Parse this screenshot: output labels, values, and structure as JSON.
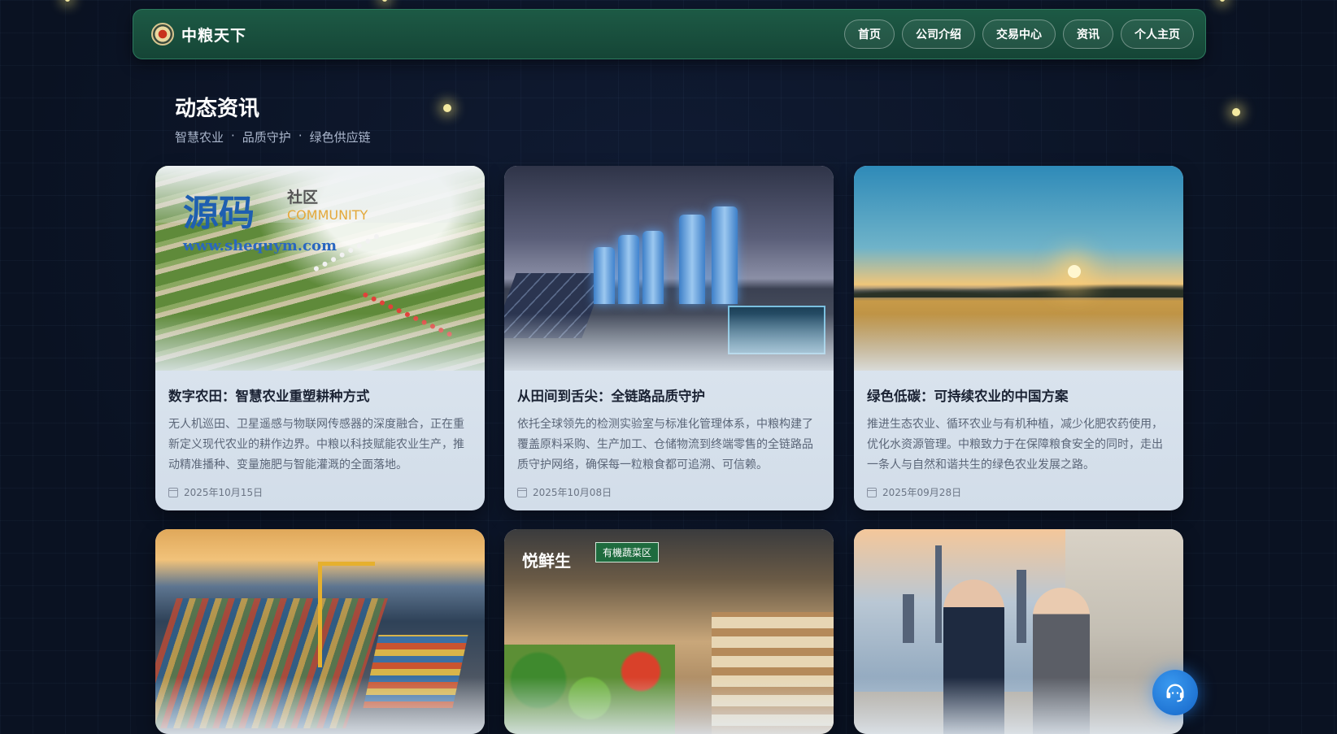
{
  "brand": {
    "name": "中粮天下"
  },
  "nav": {
    "items": [
      "首页",
      "公司介绍",
      "交易中心",
      "资讯",
      "个人主页"
    ]
  },
  "section": {
    "title": "动态资讯",
    "tags": [
      "智慧农业",
      "品质守护",
      "绿色供应链"
    ],
    "separator": "·"
  },
  "watermark": {
    "main": "源码",
    "community_cn": "社区",
    "community_en": "COMMUNITY",
    "url": "www.shequym.com"
  },
  "news": [
    {
      "title": "数字农田：智慧农业重塑耕种方式",
      "desc": "无人机巡田、卫星遥感与物联网传感器的深度融合，正在重新定义现代农业的耕作边界。中粮以科技赋能农业生产，推动精准播种、变量施肥与智能灌溉的全面落地。",
      "date": "2025年10月15日"
    },
    {
      "title": "从田间到舌尖：全链路品质守护",
      "desc": "依托全球领先的检测实验室与标准化管理体系，中粮构建了覆盖原料采购、生产加工、仓储物流到终端零售的全链路品质守护网络，确保每一粒粮食都可追溯、可信赖。",
      "date": "2025年10月08日"
    },
    {
      "title": "绿色低碳：可持续农业的中国方案",
      "desc": "推进生态农业、循环农业与有机种植，减少化肥农药使用，优化水资源管理。中粮致力于在保障粮食安全的同时，走出一条人与自然和谐共生的绿色农业发展之路。",
      "date": "2025年09月28日"
    }
  ],
  "market_signs": {
    "brand": "悦鲜生",
    "zone": "有機蔬菜区"
  },
  "colors": {
    "nav_bg": "#1d5a45",
    "page_bg": "#0b1426",
    "support": "#1565c8"
  },
  "icons": {
    "support": "headset-icon",
    "date": "calendar-icon"
  }
}
